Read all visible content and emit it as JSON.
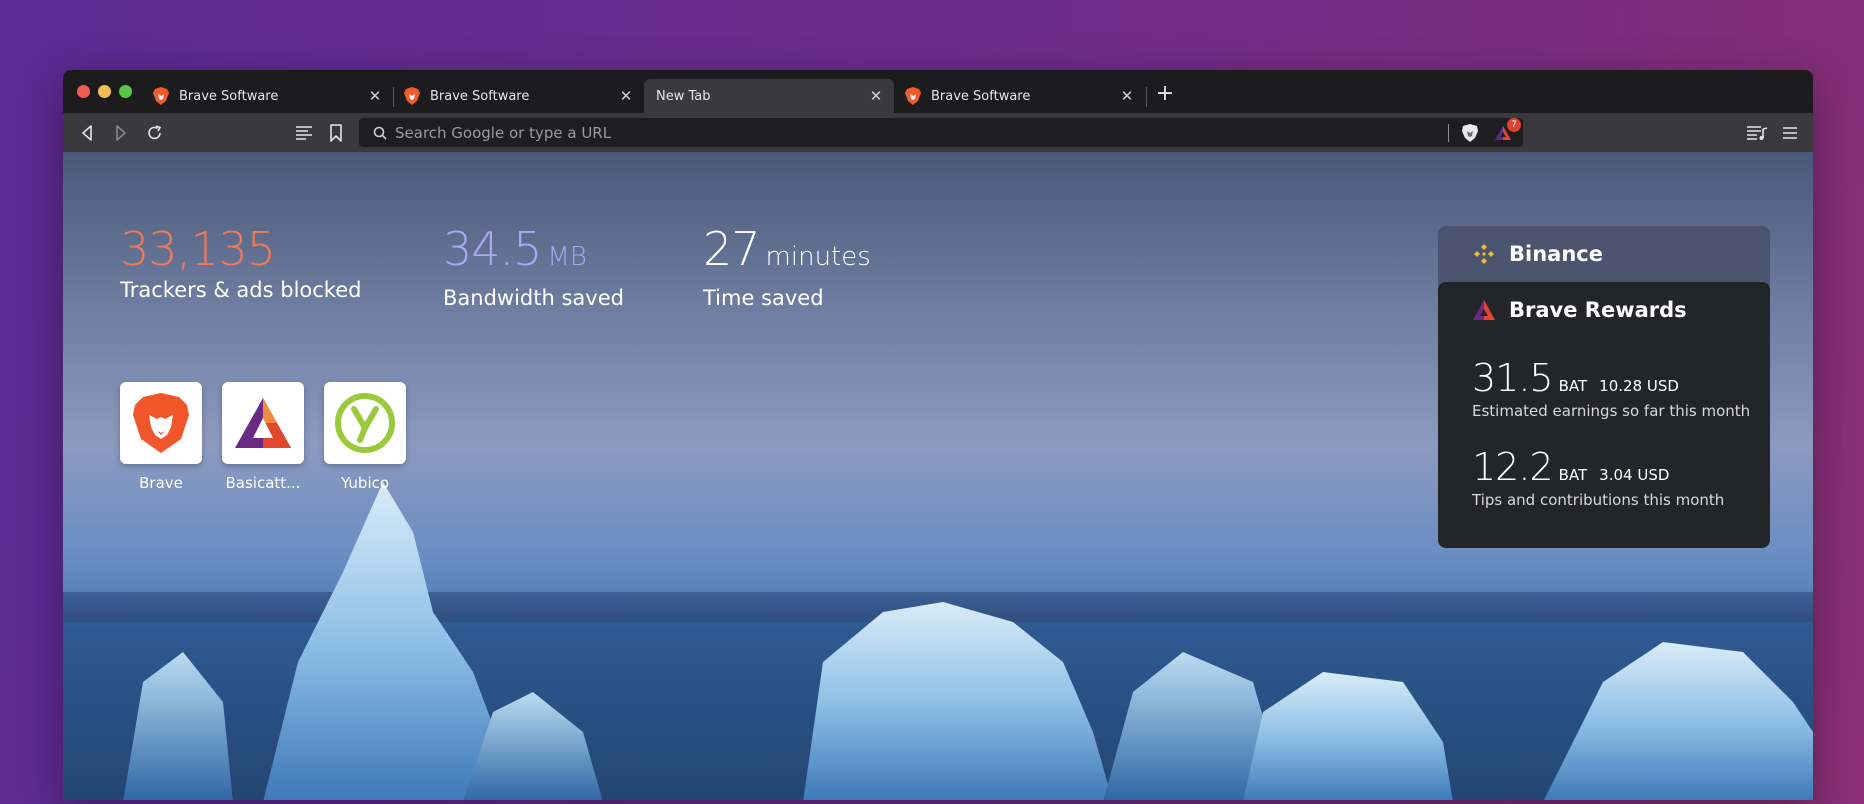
{
  "tabs": [
    {
      "title": "Brave Software",
      "active": false
    },
    {
      "title": "Brave Software",
      "active": false
    },
    {
      "title": "New Tab",
      "active": true
    },
    {
      "title": "Brave Software",
      "active": false
    }
  ],
  "toolbar": {
    "url_placeholder": "Search Google or type a URL",
    "rewards_badge": "7"
  },
  "stats": {
    "trackers": {
      "value": "33,135",
      "label": "Trackers & ads blocked",
      "color": "#f07a55"
    },
    "bandwidth": {
      "value": "34.5",
      "unit": "MB",
      "label": "Bandwidth saved",
      "color": "#a9a7f2"
    },
    "time": {
      "value": "27",
      "unit": "minutes",
      "label": "Time saved",
      "color": "#ffffff"
    }
  },
  "top_sites": [
    {
      "name": "Brave",
      "icon": "brave-lion-icon"
    },
    {
      "name": "Basicatt...",
      "icon": "bat-triangle-icon"
    },
    {
      "name": "Yubico",
      "icon": "yubico-icon"
    }
  ],
  "binance": {
    "title": "Binance",
    "icon": "binance-icon"
  },
  "rewards": {
    "title": "Brave Rewards",
    "earnings": {
      "bat": "31.5",
      "bat_unit": "BAT",
      "usd": "10.28 USD",
      "desc": "Estimated earnings so far this month"
    },
    "tips": {
      "bat": "12.2",
      "bat_unit": "BAT",
      "usd": "3.04 USD",
      "desc": "Tips and contributions this month"
    }
  }
}
